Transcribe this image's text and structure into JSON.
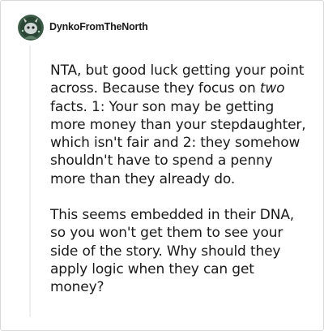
{
  "comment": {
    "author": "DynkoFromTheNorth",
    "avatar_icon": "snoo-avatar-icon",
    "paragraph1": {
      "before_italic": "NTA, but good luck getting your point across. Because they focus on ",
      "italic": "two",
      "after_italic": " facts. 1: Your son may be getting more money than your stepdaughter, which isn't fair and 2: they somehow shouldn't have to spend a penny more than they already do."
    },
    "paragraph2": "This seems embedded in their DNA, so you won't get them to see your side of the story. Why should they apply logic when they can get money?"
  },
  "colors": {
    "text": "#1a1a1b",
    "thread_line": "#edeff1",
    "border": "#d8d8d8",
    "avatar_bg": "#3b5a46"
  }
}
